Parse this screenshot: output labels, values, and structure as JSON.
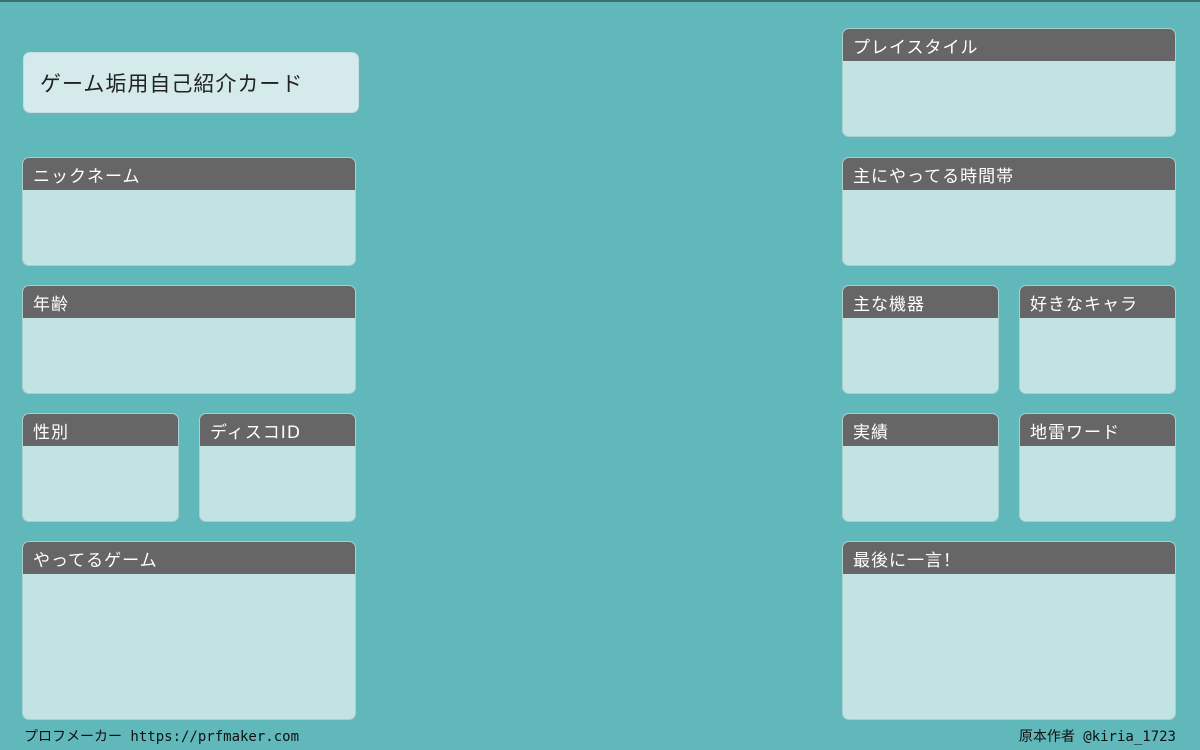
{
  "title": "ゲーム垢用自己紹介カード",
  "fields": {
    "nickname": "ニックネーム",
    "age": "年齢",
    "gender": "性別",
    "discord_id": "ディスコID",
    "games": "やってるゲーム",
    "playstyle": "プレイスタイル",
    "time_slot": "主にやってる時間帯",
    "device": "主な機器",
    "favorite_character": "好きなキャラ",
    "achievements": "実績",
    "trigger_words": "地雷ワード",
    "final_word": "最後に一言！"
  },
  "footer": {
    "left": "プロフメーカー https://prfmaker.com",
    "right": "原本作者 @kiria_1723"
  },
  "colors": {
    "background": "#60b8bb",
    "panel_header": "#666666",
    "panel_body": "#c2e3e4",
    "title_card": "#d5eaeb"
  }
}
